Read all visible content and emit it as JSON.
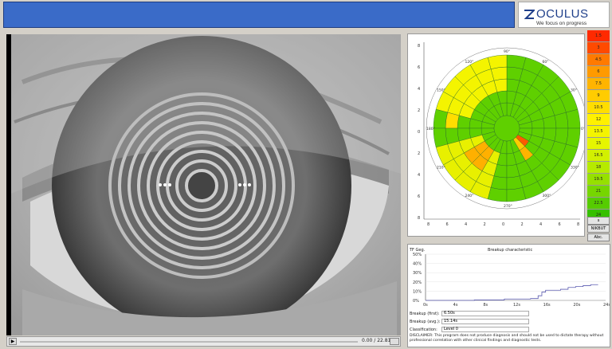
{
  "logo": {
    "brand": "OCULUS",
    "tagline": "We focus on progress",
    "icon": "oculus-z-icon"
  },
  "player": {
    "time": "0.00 / 22.81 s"
  },
  "map": {
    "angle_labels": [
      "90°",
      "120°",
      "150°",
      "180°",
      "210°",
      "240°",
      "270°",
      "300°",
      "330°",
      "0°",
      "30°",
      "60°"
    ],
    "y_ticks": [
      "8",
      "6",
      "4",
      "2",
      "0",
      "2",
      "4",
      "6",
      "8"
    ],
    "x_ticks": [
      "8",
      "6",
      "4",
      "2",
      "0",
      "2",
      "4",
      "6",
      "8"
    ]
  },
  "legend": {
    "values": [
      "1.5",
      "3",
      "4.5",
      "6",
      "7.5",
      "9",
      "10.5",
      "12",
      "13.5",
      "15",
      "16.5",
      "18",
      "19.5",
      "21",
      "22.5",
      "24"
    ],
    "colors": [
      "#ff2a00",
      "#ff4a00",
      "#ff7a00",
      "#ff9a00",
      "#ffb400",
      "#ffcc00",
      "#ffdd00",
      "#fff000",
      "#f4f400",
      "#e6f500",
      "#d2f000",
      "#b6ea00",
      "#96e000",
      "#76d600",
      "#56cc00",
      "#36c000"
    ],
    "small_label": "s"
  },
  "buttons": {
    "nikbut": "NIKBUT",
    "abc": "Abc."
  },
  "chart": {
    "title": "Breakup characteristic",
    "ylabel": "TF Geg.",
    "y_ticks": [
      "50%",
      "40%",
      "30%",
      "20%",
      "10%",
      "0%"
    ],
    "x_ticks": [
      "0s",
      "4s",
      "8s",
      "12s",
      "16s",
      "20s",
      "24s"
    ]
  },
  "chart_data": {
    "type": "line",
    "title": "Breakup characteristic",
    "ylabel": "TF Geg.",
    "xlim": [
      0,
      24
    ],
    "ylim": [
      0,
      50
    ],
    "x": [
      0,
      6.5,
      10,
      10.5,
      13,
      14,
      15,
      15.5,
      16,
      18,
      19,
      20,
      21,
      22,
      23
    ],
    "y": [
      0,
      0.5,
      0.5,
      1.5,
      1.5,
      2,
      5,
      9,
      11,
      12,
      14,
      15,
      16,
      17,
      17
    ],
    "color": "#5b5bb0"
  },
  "info": {
    "first_label": "Breakup (first):",
    "first_value": "6.50s",
    "avg_label": "Breakup (avg.):",
    "avg_value": "15.14s",
    "class_label": "Classification:",
    "class_value": "Level 0"
  },
  "disclaimer": "DISCLAIMER: This program does not produce diagnosis and should not be used to dictate therapy without professional correlation with other clinical findings and diagnostic tests."
}
